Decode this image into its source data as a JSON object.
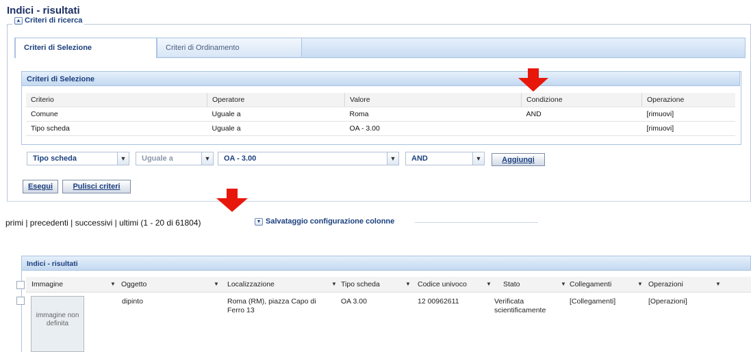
{
  "page": {
    "title": "Indici - risultati"
  },
  "criteri": {
    "legend": "Criteri di ricerca",
    "tabs": [
      {
        "label": "Criteri di Selezione"
      },
      {
        "label": "Criteri di Ordinamento"
      }
    ],
    "panel_title": "Criteri di Selezione",
    "columns": [
      "Criterio",
      "Operatore",
      "Valore",
      "Condizione",
      "Operazione"
    ],
    "rows": [
      {
        "criterio": "Comune",
        "operatore": "Uguale a",
        "valore": "Roma",
        "condizione": "AND",
        "operazione": "[rimuovi]"
      },
      {
        "criterio": "Tipo scheda",
        "operatore": "Uguale a",
        "valore": "OA - 3.00",
        "condizione": "",
        "operazione": "[rimuovi]"
      }
    ],
    "selects": {
      "criterio": "Tipo scheda",
      "operatore": "Uguale a",
      "valore": "OA - 3.00",
      "condizione": "AND"
    },
    "add_button": "Aggiungi",
    "run_button": "Esegui",
    "clear_button": "Pulisci criteri"
  },
  "pager": {
    "text": "primi | precedenti | successivi | ultimi (1 - 20 di 61804)",
    "config_label": "Salvataggio configurazione colonne"
  },
  "results": {
    "title": "Indici - risultati",
    "columns": [
      "Immagine",
      "Oggetto",
      "Localizzazione",
      "Tipo scheda",
      "Codice univoco",
      "Stato",
      "Collegamenti",
      "Operazioni"
    ],
    "rows": [
      {
        "immagine": "immagine non definita",
        "oggetto": "dipinto",
        "localizzazione": "Roma (RM), piazza Capo di Ferro 13",
        "tipo_scheda": "OA 3.00",
        "codice_univoco": "12 00962611",
        "stato": "Verificata scientificamente",
        "collegamenti": "[Collegamenti]",
        "operazioni": "[Operazioni]"
      }
    ]
  },
  "colors": {
    "accent": "#1b3f7e",
    "arrow": "#e8170c"
  }
}
